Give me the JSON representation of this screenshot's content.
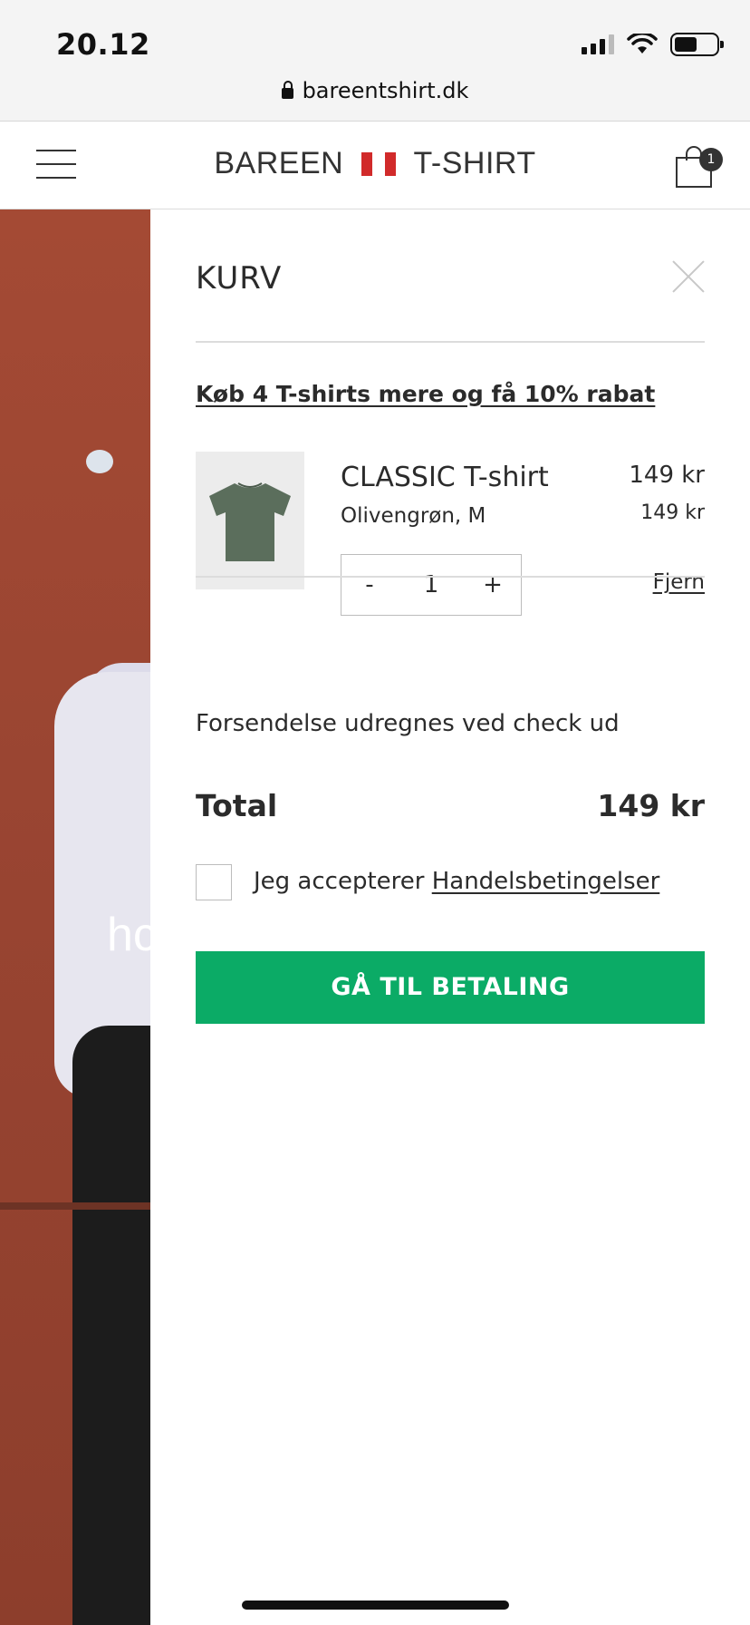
{
  "status_bar": {
    "time": "20.12",
    "url": "bareentshirt.dk"
  },
  "header": {
    "logo_left": "BAREEN",
    "logo_right": "T-SHIRT",
    "cart_count": "1",
    "flag_color": "#d12a2a"
  },
  "backdrop": {
    "partial_text": "hc"
  },
  "cart": {
    "title": "KURV",
    "promo": "Køb 4 T-shirts mere og få 10% rabat",
    "item": {
      "name": "CLASSIC T-shirt",
      "variant": "Olivengrøn, M",
      "price": "149 kr",
      "unit_price": "149 kr",
      "quantity": "1",
      "minus_label": "-",
      "plus_label": "+",
      "remove_label": "Fjern",
      "tshirt_color": "#5b6e5c"
    },
    "shipping_note": "Forsendelse udregnes ved check ud",
    "total_label": "Total",
    "total_value": "149 kr",
    "terms_prefix": "Jeg accepterer",
    "terms_link": "Handelsbetingelser",
    "checkout_button": "GÅ TIL BETALING",
    "button_color": "#0bab66"
  }
}
